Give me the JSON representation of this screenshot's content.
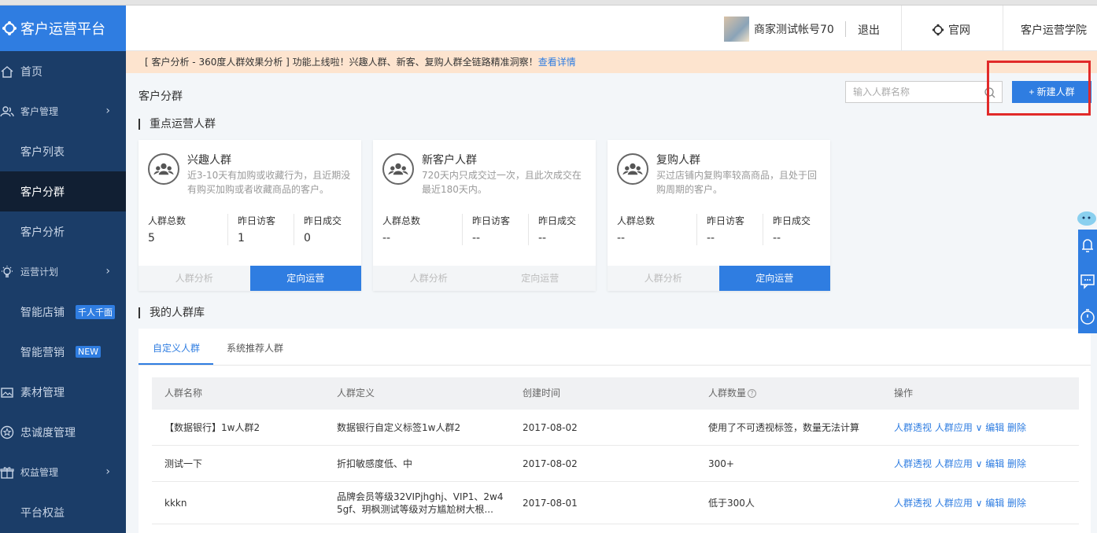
{
  "app": {
    "title": "客户运营平台"
  },
  "sidebar": {
    "items": [
      {
        "label": "首页"
      },
      {
        "label": "客户管理"
      },
      {
        "label": "客户列表"
      },
      {
        "label": "客户分群"
      },
      {
        "label": "客户分析"
      },
      {
        "label": "运营计划"
      },
      {
        "label": "智能店铺",
        "tag": "千人千面"
      },
      {
        "label": "智能营销",
        "tag": "NEW"
      },
      {
        "label": "素材管理"
      },
      {
        "label": "忠诚度管理"
      },
      {
        "label": "权益管理"
      },
      {
        "label": "平台权益"
      }
    ]
  },
  "header": {
    "account": "商家测试帐号70",
    "logout": "退出",
    "site": "官网",
    "academy": "客户运营学院"
  },
  "notice": {
    "text": "[ 客户分析 - 360度人群效果分析 ] 功能上线啦！兴趣人群、新客、复购人群全链路精准洞察！",
    "link": "查看详情"
  },
  "page": {
    "title": "客户分群",
    "search_placeholder": "输入人群名称",
    "new_button": "+ 新建人群",
    "key_section": "重点运营人群",
    "library_section": "我的人群库"
  },
  "cards": [
    {
      "title": "兴趣人群",
      "desc": "近3-10天有加购或收藏行为，且近期没有购买加购或者收藏商品的客户。",
      "stats": [
        {
          "label": "人群总数",
          "value": "5"
        },
        {
          "label": "昨日访客",
          "value": "1"
        },
        {
          "label": "昨日成交",
          "value": "0"
        }
      ],
      "analyze": "人群分析",
      "operate": "定向运营"
    },
    {
      "title": "新客户人群",
      "desc": "720天内只成交过一次，且此次成交在最近180天内。",
      "stats": [
        {
          "label": "人群总数",
          "value": "--"
        },
        {
          "label": "昨日访客",
          "value": "--"
        },
        {
          "label": "昨日成交",
          "value": "--"
        }
      ],
      "analyze": "人群分析",
      "operate": "定向运营"
    },
    {
      "title": "复购人群",
      "desc": "买过店铺内复购率较高商品，且处于回购周期的客户。",
      "stats": [
        {
          "label": "人群总数",
          "value": "--"
        },
        {
          "label": "昨日访客",
          "value": "--"
        },
        {
          "label": "昨日成交",
          "value": "--"
        }
      ],
      "analyze": "人群分析",
      "operate": "定向运营"
    }
  ],
  "library": {
    "tabs": [
      {
        "label": "自定义人群"
      },
      {
        "label": "系统推荐人群"
      }
    ],
    "columns": [
      "人群名称",
      "人群定义",
      "创建时间",
      "人群数量",
      "操作"
    ],
    "rows": [
      {
        "name": "【数据银行】1w人群2",
        "definition": "数据银行自定义标签1w人群2",
        "created": "2017-08-02",
        "count": "使用了不可透视标签，数量无法计算",
        "actions": "人群透视 人群应用 ∨ 编辑 删除"
      },
      {
        "name": "测试一下",
        "definition": "折扣敏感度低、中",
        "created": "2017-08-02",
        "count": "300+",
        "actions": "人群透视 人群应用 ∨ 编辑 删除"
      },
      {
        "name": "kkkn",
        "definition": "品牌会员等级32VIPjhghj、VIP1、2w4 5gf、玥枫测试等级对方尴尬树大根...",
        "created": "2017-08-01",
        "count": "低于300人",
        "actions": "人群透视 人群应用 ∨ 编辑 删除"
      }
    ]
  },
  "colors": {
    "primary": "#2f7de1",
    "sidebar": "#1b3d68",
    "highlight": "#e12a2a"
  }
}
